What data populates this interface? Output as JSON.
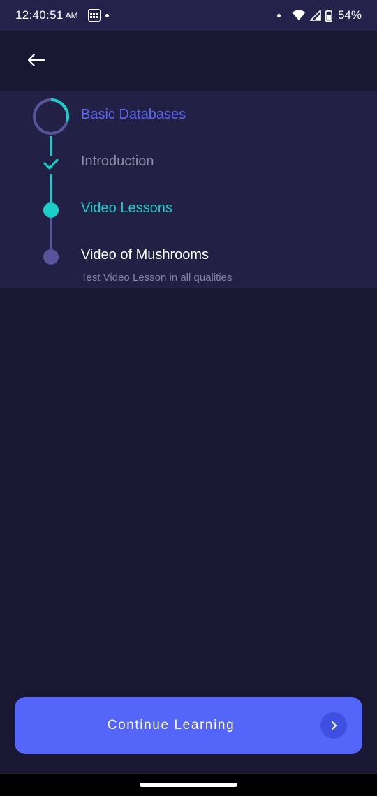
{
  "status_bar": {
    "time": "12:40:51",
    "ampm": "AM",
    "battery": "54%",
    "icons": [
      "grid-icon",
      "dot-icon",
      "wifi-icon",
      "signal-icon",
      "battery-icon"
    ]
  },
  "header": {
    "back_icon": "arrow-left-icon"
  },
  "timeline": {
    "course_title": "Basic Databases",
    "course_progress_fraction": 0.3,
    "steps": [
      {
        "label": "Introduction",
        "state": "completed"
      },
      {
        "label": "Video Lessons",
        "state": "active"
      },
      {
        "label": "Video of Mushrooms",
        "state": "current",
        "subtitle": "Test Video Lesson in all qualities"
      }
    ]
  },
  "continue": {
    "label": "Continue Learning",
    "icon": "chevron-right-icon"
  },
  "colors": {
    "background": "#1a1733",
    "panel": "#232046",
    "accent_blue": "#5465fa",
    "accent_teal": "#19cfc8",
    "muted": "#8f8ba8"
  }
}
